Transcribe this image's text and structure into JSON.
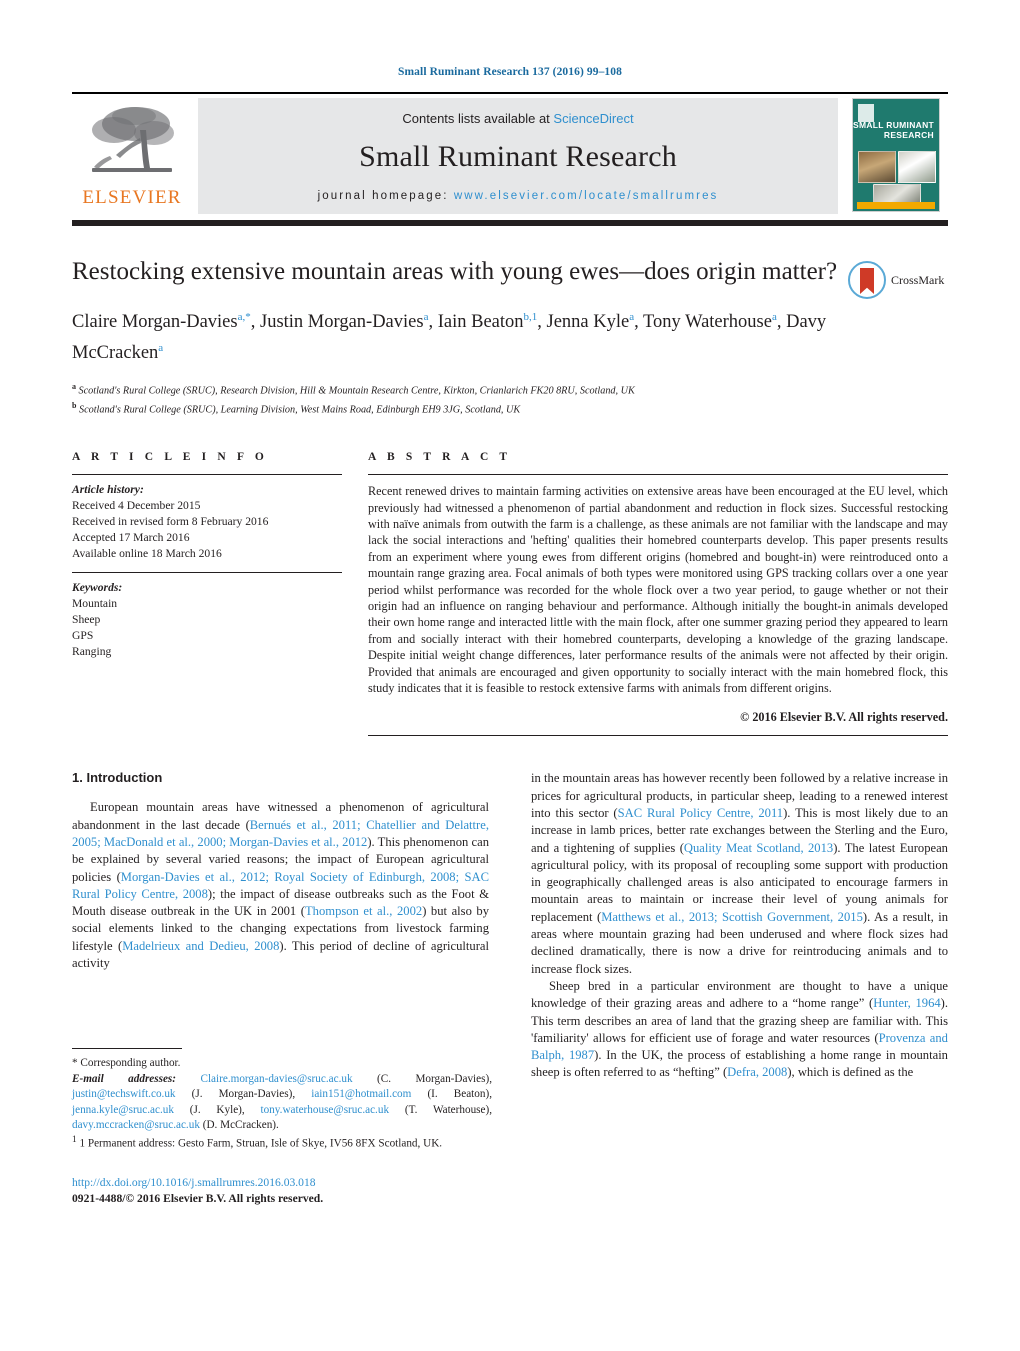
{
  "running_head": "Small Ruminant Research 137 (2016) 99–108",
  "masthead": {
    "publisher_name": "ELSEVIER",
    "contents_prefix": "Contents lists available at ",
    "contents_link": "ScienceDirect",
    "journal_title": "Small Ruminant Research",
    "homepage_prefix": "journal homepage: ",
    "homepage_url": "www.elsevier.com/locate/smallrumres",
    "cover_title": "SMALL RUMINANT RESEARCH"
  },
  "article": {
    "title": "Restocking extensive mountain areas with young ewes—does origin matter?",
    "crossmark_label": "CrossMark",
    "authors_html": "Claire Morgan-Davies<sup>a,*</sup>, Justin Morgan-Davies<sup>a</sup>, Iain Beaton<sup>b,1</sup>, Jenna Kyle<sup>a</sup>, Tony Waterhouse<sup>a</sup>, Davy McCracken<sup>a</sup>",
    "affiliation_a": "Scotland's Rural College (SRUC), Research Division, Hill & Mountain Research Centre, Kirkton, Crianlarich FK20 8RU, Scotland, UK",
    "affiliation_b": "Scotland's Rural College (SRUC), Learning Division, West Mains Road, Edinburgh EH9 3JG, Scotland, UK"
  },
  "article_info": {
    "section_label": "A R T I C L E   I N F O",
    "history_label": "Article history:",
    "history": [
      "Received 4 December 2015",
      "Received in revised form 8 February 2016",
      "Accepted 17 March 2016",
      "Available online 18 March 2016"
    ],
    "keywords_label": "Keywords:",
    "keywords": [
      "Mountain",
      "Sheep",
      "GPS",
      "Ranging"
    ]
  },
  "abstract": {
    "section_label": "A B S T R A C T",
    "text": "Recent renewed drives to maintain farming activities on extensive areas have been encouraged at the EU level, which previously had witnessed a phenomenon of partial abandonment and reduction in flock sizes. Successful restocking with naïve animals from outwith the farm is a challenge, as these animals are not familiar with the landscape and may lack the social interactions and 'hefting' qualities their homebred counterparts develop. This paper presents results from an experiment where young ewes from different origins (homebred and bought-in) were reintroduced onto a mountain range grazing area. Focal animals of both types were monitored using GPS tracking collars over a one year period whilst performance was recorded for the whole flock over a two year period, to gauge whether or not their origin had an influence on ranging behaviour and performance. Although initially the bought-in animals developed their own home range and interacted little with the main flock, after one summer grazing period they appeared to learn from and socially interact with their homebred counterparts, developing a knowledge of the grazing landscape. Despite initial weight change differences, later performance results of the animals were not affected by their origin. Provided that animals are encouraged and given opportunity to socially interact with the main homebred flock, this study indicates that it is feasible to restock extensive farms with animals from different origins.",
    "copyright": "© 2016 Elsevier B.V. All rights reserved."
  },
  "introduction": {
    "heading": "1.  Introduction",
    "left_para_html": "European mountain areas have witnessed a phenomenon of agricultural abandonment in the last decade (<span class=\"ref\">Bernués et al., 2011; Chatellier and Delattre, 2005; MacDonald et al., 2000; Morgan-Davies et al., 2012</span>). This phenomenon can be explained by several varied reasons; the impact of European agricultural policies (<span class=\"ref\">Morgan-Davies et al., 2012; Royal Society of Edinburgh, 2008; SAC Rural Policy Centre, 2008</span>); the impact of disease outbreaks such as the Foot &amp; Mouth disease outbreak in the UK in 2001 (<span class=\"ref\">Thompson et al., 2002</span>) but also by social elements linked to the changing expectations from livestock farming lifestyle (<span class=\"ref\">Madelrieux and Dedieu, 2008</span>). This period of decline of agricultural activity",
    "right_para1_html": "in the mountain areas has however recently been followed by a relative increase in prices for agricultural products, in particular sheep, leading to a renewed interest into this sector (<span class=\"ref\">SAC Rural Policy Centre, 2011</span>). This is most likely due to an increase in lamb prices, better rate exchanges between the Sterling and the Euro, and a tightening of supplies (<span class=\"ref\">Quality Meat Scotland, 2013</span>). The latest European agricultural policy, with its proposal of recoupling some support with production in geographically challenged areas is also anticipated to encourage farmers in mountain areas to maintain or increase their level of young animals for replacement (<span class=\"ref\">Matthews et al., 2013; Scottish Government, 2015</span>). As a result, in areas where mountain grazing had been underused and where flock sizes had declined dramatically, there is now a drive for reintroducing animals and to increase flock sizes.",
    "right_para2_html": "Sheep bred in a particular environment are thought to have a unique knowledge of their grazing areas and adhere to a “home range” (<span class=\"ref\">Hunter, 1964</span>). This term describes an area of land that the grazing sheep are familiar with. This 'familiarity' allows for efficient use of forage and water resources (<span class=\"ref\">Provenza and Balph, 1987</span>). In the UK, the process of establishing a home range in mountain sheep is often referred to as “hefting” (<span class=\"ref\">Defra, 2008</span>), which is defined as the"
  },
  "footnotes": {
    "corresponding": "*  Corresponding author.",
    "emails_html": "<span class=\"ital\">E-mail addresses:</span> <span class=\"link\">Claire.morgan-davies@sruc.ac.uk</span> (C. Morgan-Davies), <span class=\"link\">justin@techswift.co.uk</span> (J. Morgan-Davies), <span class=\"link\">iain151@hotmail.com</span> (I. Beaton), <span class=\"link\">jenna.kyle@sruc.ac.uk</span> (J. Kyle), <span class=\"link\">tony.waterhouse@sruc.ac.uk</span> (T. Waterhouse), <span class=\"link\">davy.mccracken@sruc.ac.uk</span> (D. McCracken).",
    "permanent_address": "1  Permanent address: Gesto Farm, Struan, Isle of Skye, IV56 8FX Scotland, UK.",
    "doi": "http://dx.doi.org/10.1016/j.smallrumres.2016.03.018",
    "issn_line": "0921-4488/© 2016 Elsevier B.V. All rights reserved."
  },
  "colors": {
    "link_blue": "#2f8fce",
    "elsevier_orange": "#E87722",
    "cover_teal": "#1f7a6e",
    "crossmark_red": "#cf3a27"
  }
}
